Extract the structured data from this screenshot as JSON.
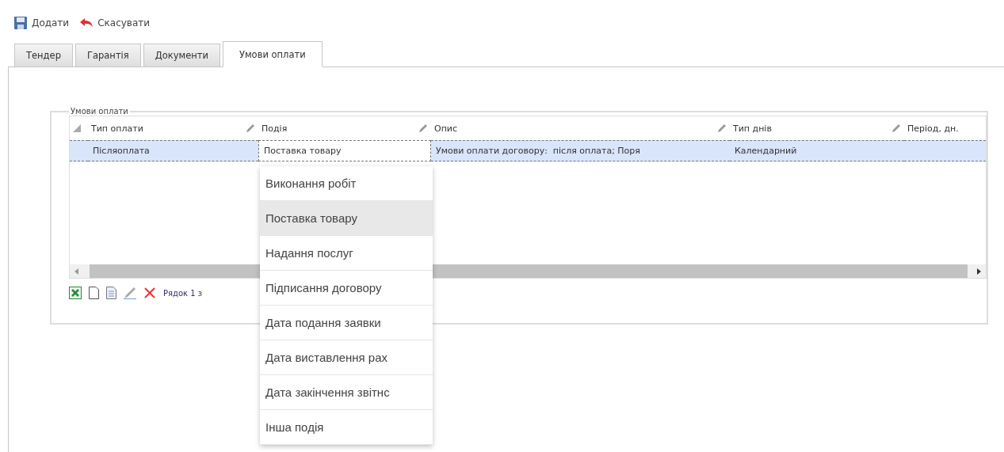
{
  "toolbar": [
    {
      "kind": "save",
      "label": "Додати"
    },
    {
      "kind": "undo",
      "label": "Скасувати"
    }
  ],
  "tabs": [
    {
      "label": "Тендер",
      "selected": false
    },
    {
      "label": "Гарантія",
      "selected": false
    },
    {
      "label": "Документи",
      "selected": false
    },
    {
      "label": "Умови оплати",
      "selected": true
    }
  ],
  "group": {
    "title": "Умови оплати",
    "table": {
      "columns": [
        "Тип оплати",
        "Подія",
        "Опис",
        "Тип днів",
        "Період, дн."
      ],
      "rows": [
        {
          "selected": true,
          "cells": [
            "Післяоплата",
            "Поставка товару",
            "Умови оплати договору:  після оплата; Поря",
            "Календарний",
            ""
          ]
        }
      ]
    },
    "pager": {
      "text": "Рядок 1 з"
    }
  },
  "dropdown": {
    "items": [
      {
        "label": "Виконання робіт",
        "selected": false
      },
      {
        "label": "Поставка товару",
        "selected": true
      },
      {
        "label": "Надання послуг",
        "selected": false
      },
      {
        "label": "Підписання договору",
        "selected": false
      },
      {
        "label": "Дата подання заявки",
        "selected": false
      },
      {
        "label": "Дата виставлення рах",
        "selected": false
      },
      {
        "label": "Дата закінчення звітнс",
        "selected": false
      },
      {
        "label": "Інша подія",
        "selected": false
      }
    ]
  }
}
